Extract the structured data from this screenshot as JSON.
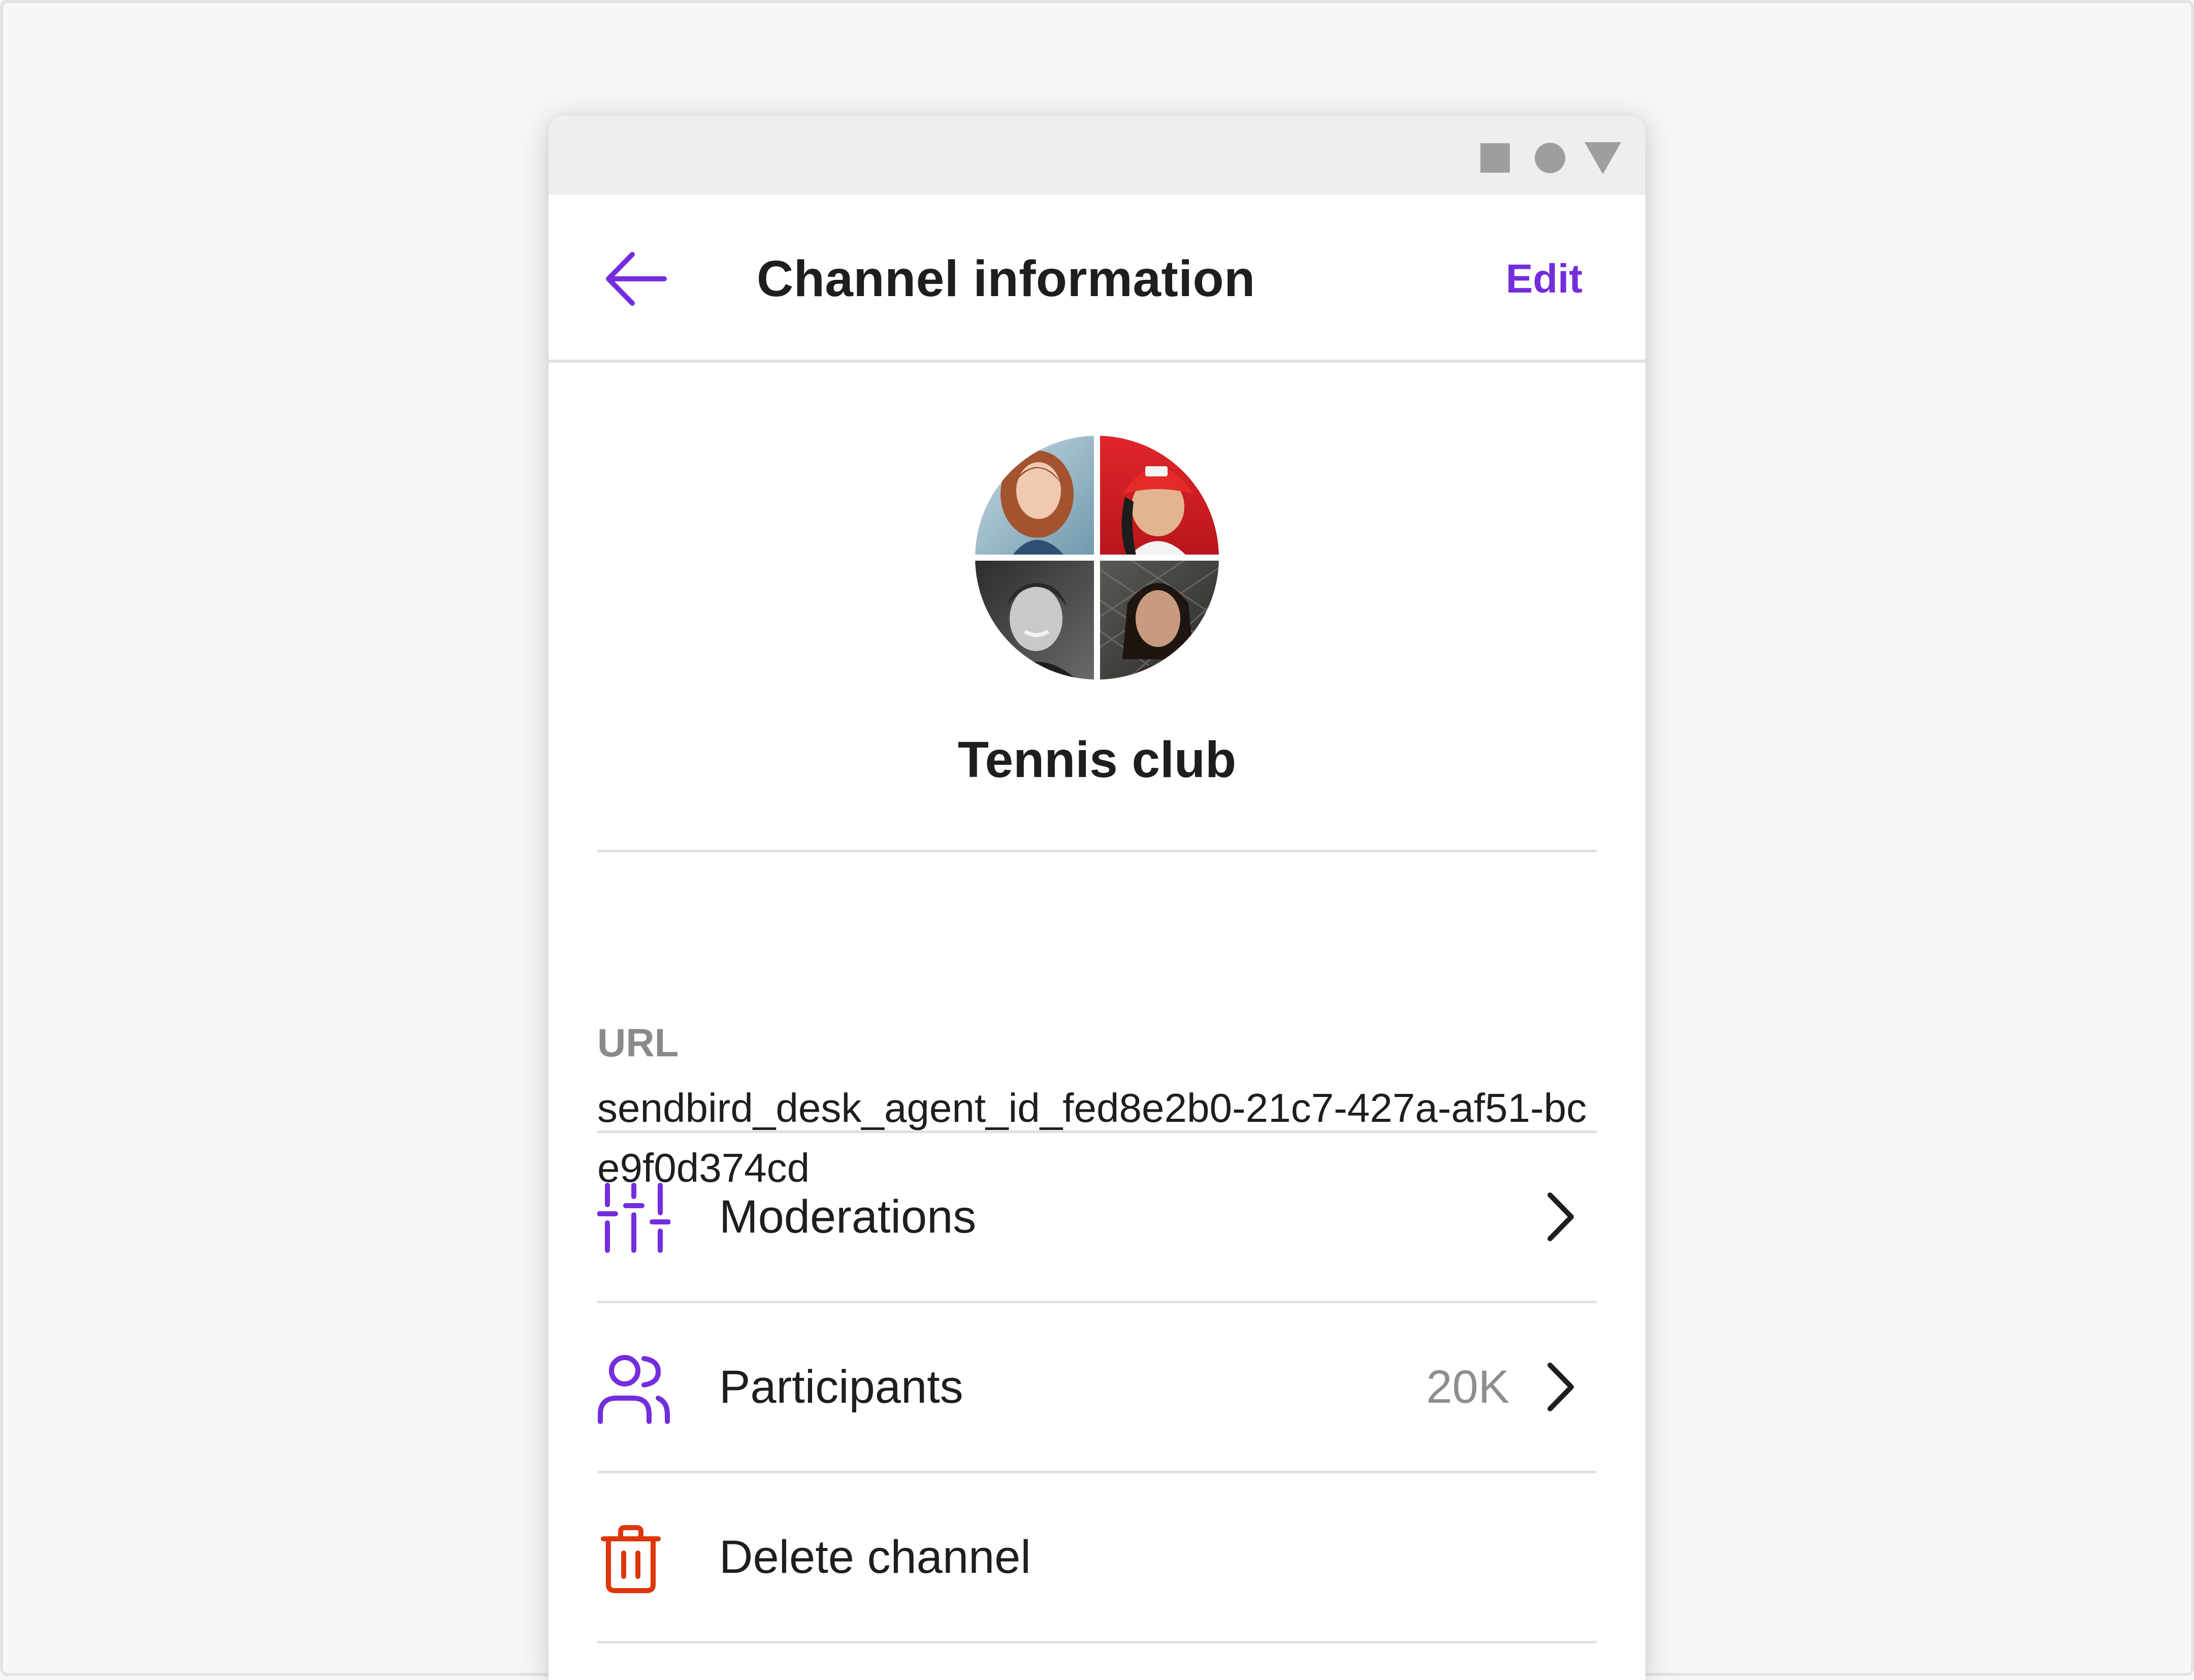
{
  "status_bar": {
    "icons": [
      "square-icon",
      "circle-icon",
      "triangle-icon"
    ]
  },
  "header": {
    "title": "Channel information",
    "edit_label": "Edit",
    "back_icon": "arrow-left-icon"
  },
  "channel": {
    "name": "Tennis club"
  },
  "url_section": {
    "label": "URL",
    "value": "sendbird_desk_agent_id_fed8e2b0-21c7-427a-af51-bce9f0d374cd"
  },
  "menu": [
    {
      "label": "Moderations",
      "icon": "sliders-icon",
      "count": ""
    },
    {
      "label": "Participants",
      "icon": "users-icon",
      "count": "20K"
    },
    {
      "label": "Delete channel",
      "icon": "trash-icon",
      "count": ""
    }
  ],
  "colors": {
    "accent": "#742ddd",
    "danger": "#de360b",
    "text": "#1e1e1e",
    "muted": "#8e8e8e",
    "divider": "#e0e0e0"
  }
}
